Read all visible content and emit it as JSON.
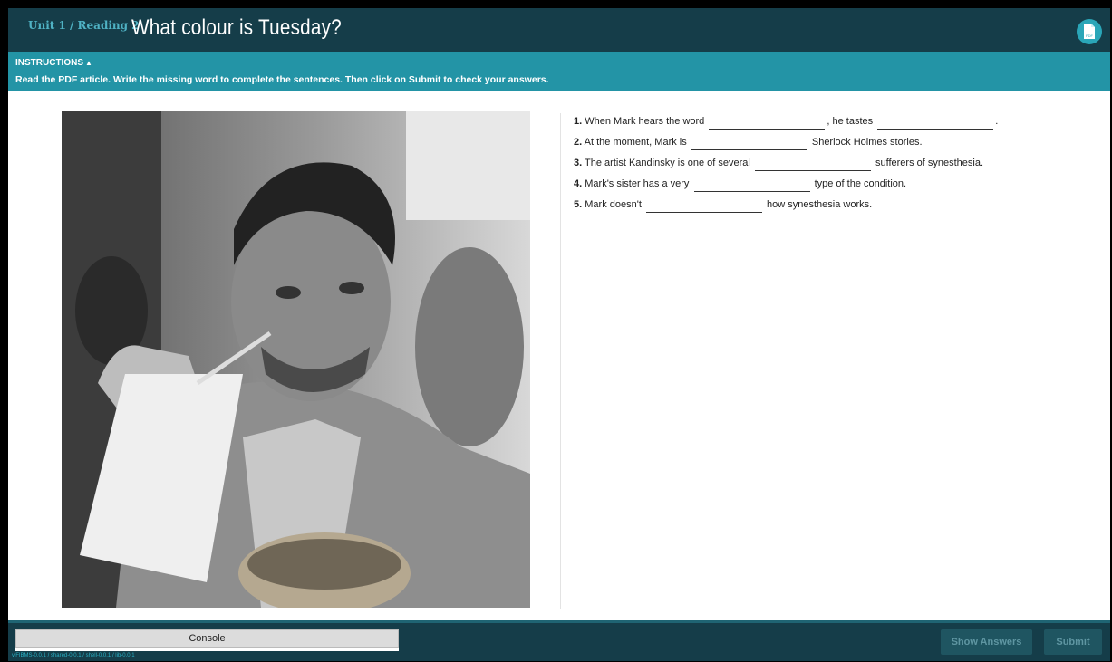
{
  "header": {
    "breadcrumb": "Unit 1 / Reading 2",
    "title": "What colour is Tuesday?",
    "pdf_icon": "pdf-icon",
    "pdf_label": "PDF"
  },
  "instructions": {
    "title": "INSTRUCTIONS",
    "toggle_glyph": "▲",
    "text": "Read the PDF article. Write the missing word to complete the sentences. Then click on Submit to check your answers."
  },
  "image": {
    "alt": "Man drinking from a large cup and holding a burger"
  },
  "questions": [
    {
      "num": "1.",
      "parts": [
        "When Mark hears the word",
        ", he tastes",
        "."
      ]
    },
    {
      "num": "2.",
      "parts": [
        "At the moment, Mark is",
        "Sherlock Holmes stories."
      ]
    },
    {
      "num": "3.",
      "parts": [
        "The artist Kandinsky is one of several",
        "sufferers of synesthesia."
      ]
    },
    {
      "num": "4.",
      "parts": [
        "Mark's sister has a very",
        "type of the condition."
      ]
    },
    {
      "num": "5.",
      "parts": [
        "Mark doesn't",
        "how synesthesia works."
      ]
    }
  ],
  "footer": {
    "console_label": "Console",
    "version": "v.FIBMS-0.0.1 / shared-0.0.1 / shell-0.0.1 / lib-0.0.1",
    "show_answers_label": "Show Answers",
    "submit_label": "Submit"
  },
  "colors": {
    "header_bg": "#153d49",
    "instructions_bg": "#2394a6",
    "accent": "#2aa6b8"
  }
}
